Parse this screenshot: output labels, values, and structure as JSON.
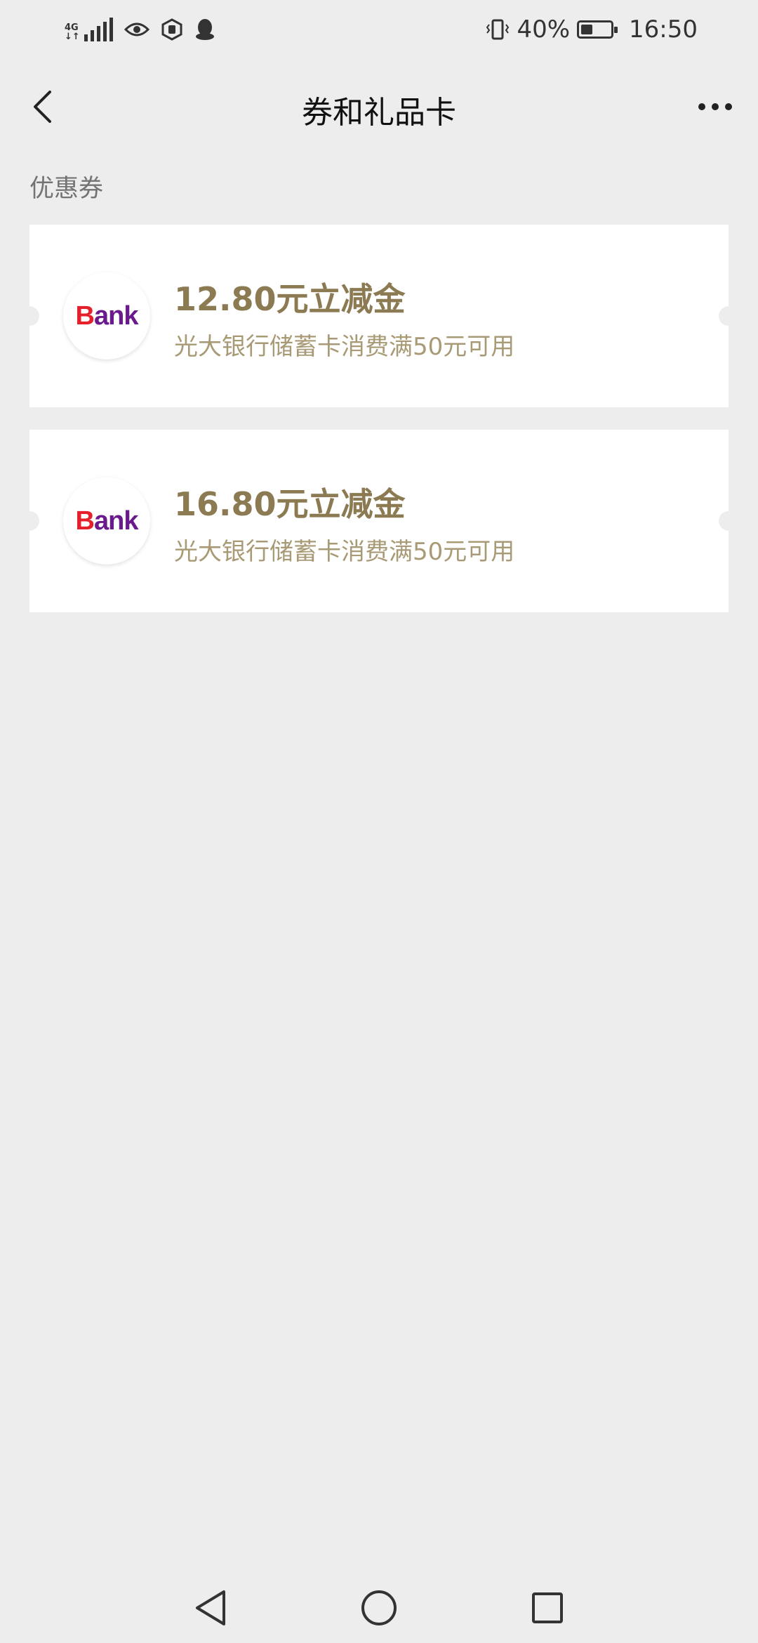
{
  "status_bar": {
    "network": "4G",
    "battery_percent": "40%",
    "battery_level": 0.4,
    "time": "16:50",
    "icons": [
      "signal-icon",
      "eye-icon",
      "shield-hand-icon",
      "qq-penguin-icon",
      "vibrate-icon",
      "battery-icon"
    ]
  },
  "header": {
    "title": "券和礼品卡",
    "back_icon": "back-chevron-icon",
    "more_icon": "more-dots-icon"
  },
  "section": {
    "label": "优惠券"
  },
  "coupons": [
    {
      "logo_text_b": "B",
      "logo_text_rest": "ank",
      "amount": "12.80元立减金",
      "description": "光大银行储蓄卡消费满50元可用"
    },
    {
      "logo_text_b": "B",
      "logo_text_rest": "ank",
      "amount": "16.80元立减金",
      "description": "光大银行储蓄卡消费满50元可用"
    }
  ],
  "system_nav": {
    "icons": [
      "back-triangle-icon",
      "home-circle-icon",
      "recents-square-icon"
    ]
  },
  "colors": {
    "background": "#ededed",
    "coupon_title": "#8b7a52",
    "coupon_desc": "#a99a76",
    "logo_red": "#e5202a",
    "logo_purple": "#6a1a8c"
  }
}
